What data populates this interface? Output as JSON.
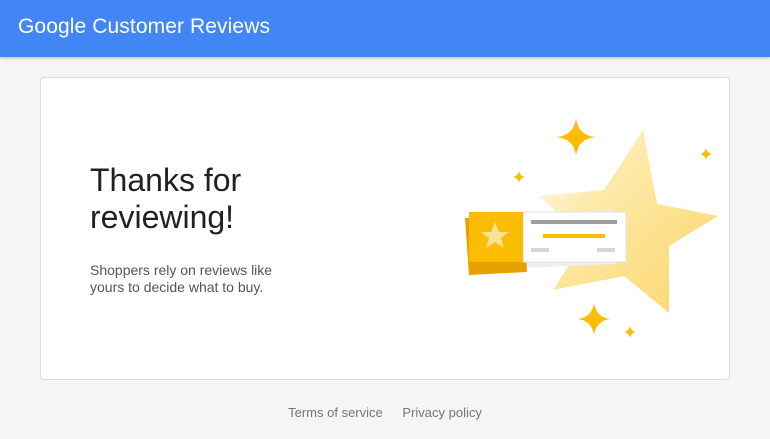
{
  "header": {
    "brand": "Google Customer Reviews",
    "background_color": "#4285f4"
  },
  "card": {
    "title": "Thanks for reviewing!",
    "subtitle": "Shoppers rely on reviews like yours to decide what to buy.",
    "illustration_icons": [
      "large-star-icon",
      "review-ticket-icon",
      "sparkle-icon"
    ]
  },
  "footer": {
    "links": [
      {
        "label": "Terms of service"
      },
      {
        "label": "Privacy policy"
      }
    ]
  },
  "colors": {
    "accent_yellow": "#fbbc04",
    "dark_yellow": "#e8a000",
    "text_dark": "#212121",
    "text_muted": "#555555"
  }
}
